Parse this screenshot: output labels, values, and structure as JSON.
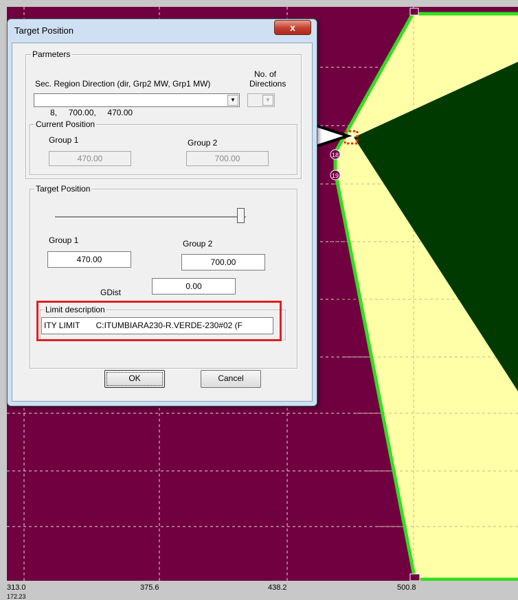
{
  "plot": {
    "background": "#700040",
    "region_fill": "#ffffa8",
    "boundary_color": "#33dd22",
    "dark_region": "#003a00",
    "points": [
      {
        "label": "18"
      },
      {
        "label": "19"
      }
    ],
    "x_ticks": [
      "313.0",
      "375.6",
      "438.2",
      "500.8"
    ],
    "y_partial": "172.23"
  },
  "dialog": {
    "title": "Target Position",
    "close_symbol": "x",
    "parameters": {
      "legend": "Parmeters",
      "direction_label": "Sec. Region Direction (dir, Grp2 MW, Grp1 MW)",
      "num_dirs_label_1": "No. of",
      "num_dirs_label_2": "Directions",
      "direction_value": "8,     700.00,     470.00",
      "num_dirs_value": ""
    },
    "current_position": {
      "legend": "Current Position",
      "group1_label": "Group 1",
      "group2_label": "Group 2",
      "group1_value": "470.00",
      "group2_value": "700.00"
    },
    "target_position": {
      "legend": "Target Position",
      "slider_level": 1.0,
      "group1_label": "Group 1",
      "group2_label": "Group 2",
      "group1_value": "470.00",
      "group2_value": "700.00",
      "gdist_label": "GDist",
      "gdist_value": "0.00"
    },
    "limit": {
      "legend": "Limit description",
      "value": "ITY LIMIT       C:ITUMBIARA230-R.VERDE-230#02 (F"
    },
    "ok_label": "OK",
    "cancel_label": "Cancel"
  }
}
